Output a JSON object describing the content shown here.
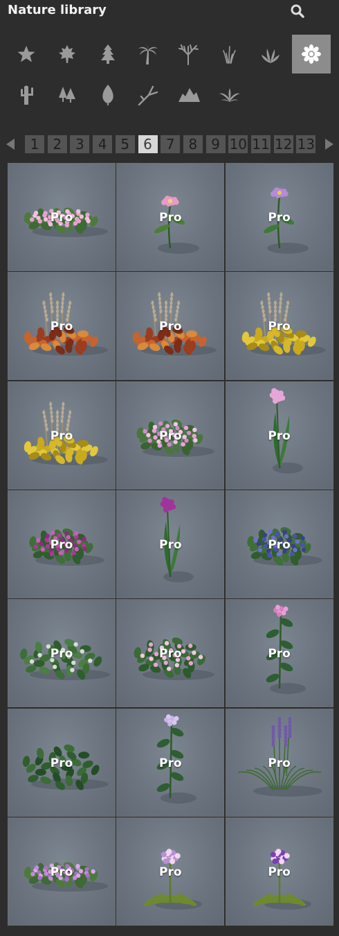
{
  "header": {
    "title": "Nature library",
    "search_icon": "search-icon"
  },
  "colors": {
    "background": "#2d2d2d",
    "icon": "#9a9a9a",
    "selected_bg": "#8c8c8c",
    "tile_bg": "#6c757f",
    "page_bg": "#545454",
    "page_current_bg": "#d8d8d8"
  },
  "categories": [
    {
      "name": "favorites",
      "icon": "star-icon",
      "selected": false
    },
    {
      "name": "leaves",
      "icon": "maple-leaf-icon",
      "selected": false
    },
    {
      "name": "conifers",
      "icon": "pine-tree-icon",
      "selected": false
    },
    {
      "name": "palms",
      "icon": "palm-tree-icon",
      "selected": false
    },
    {
      "name": "bare-trees",
      "icon": "bare-tree-icon",
      "selected": false
    },
    {
      "name": "grass",
      "icon": "grass-icon",
      "selected": false
    },
    {
      "name": "plants",
      "icon": "plant-icon",
      "selected": false
    },
    {
      "name": "flowers",
      "icon": "flower-icon",
      "selected": true
    },
    {
      "name": "cactus",
      "icon": "cactus-icon",
      "selected": false
    },
    {
      "name": "forest",
      "icon": "trees-icon",
      "selected": false
    },
    {
      "name": "leaf",
      "icon": "leaf-icon",
      "selected": false
    },
    {
      "name": "branches",
      "icon": "branch-icon",
      "selected": false
    },
    {
      "name": "rocks",
      "icon": "rocks-icon",
      "selected": false
    },
    {
      "name": "ferns",
      "icon": "fern-icon",
      "selected": false
    }
  ],
  "pagination": {
    "pages": [
      "1",
      "2",
      "3",
      "4",
      "5",
      "6",
      "7",
      "8",
      "9",
      "10",
      "11",
      "12",
      "13"
    ],
    "current": "6",
    "prev_icon": "arrow-left-icon",
    "next_icon": "arrow-right-icon"
  },
  "tiles": [
    {
      "badge": "Pro",
      "plant": "pink-flower-bed"
    },
    {
      "badge": "Pro",
      "plant": "pink-single-flower"
    },
    {
      "badge": "Pro",
      "plant": "purple-daisy"
    },
    {
      "badge": "Pro",
      "plant": "red-coleus-grass"
    },
    {
      "badge": "Pro",
      "plant": "red-coleus-grass"
    },
    {
      "badge": "Pro",
      "plant": "yellow-coleus-grass"
    },
    {
      "badge": "Pro",
      "plant": "yellow-coleus-grass"
    },
    {
      "badge": "Pro",
      "plant": "pink-flower-bush"
    },
    {
      "badge": "Pro",
      "plant": "pink-lily"
    },
    {
      "badge": "Pro",
      "plant": "magenta-flower-bush"
    },
    {
      "badge": "Pro",
      "plant": "magenta-iris"
    },
    {
      "badge": "Pro",
      "plant": "blue-flower-bush"
    },
    {
      "badge": "Pro",
      "plant": "green-bush"
    },
    {
      "badge": "Pro",
      "plant": "pink-dotted-bush"
    },
    {
      "badge": "Pro",
      "plant": "tall-pink-flower"
    },
    {
      "badge": "Pro",
      "plant": "dark-green-bush"
    },
    {
      "badge": "Pro",
      "plant": "tall-lilac-flower"
    },
    {
      "badge": "Pro",
      "plant": "lavender-grass"
    },
    {
      "badge": "Pro",
      "plant": "lilac-flower-bed"
    },
    {
      "badge": "Pro",
      "plant": "lilac-primrose"
    },
    {
      "badge": "Pro",
      "plant": "purple-primrose"
    }
  ]
}
